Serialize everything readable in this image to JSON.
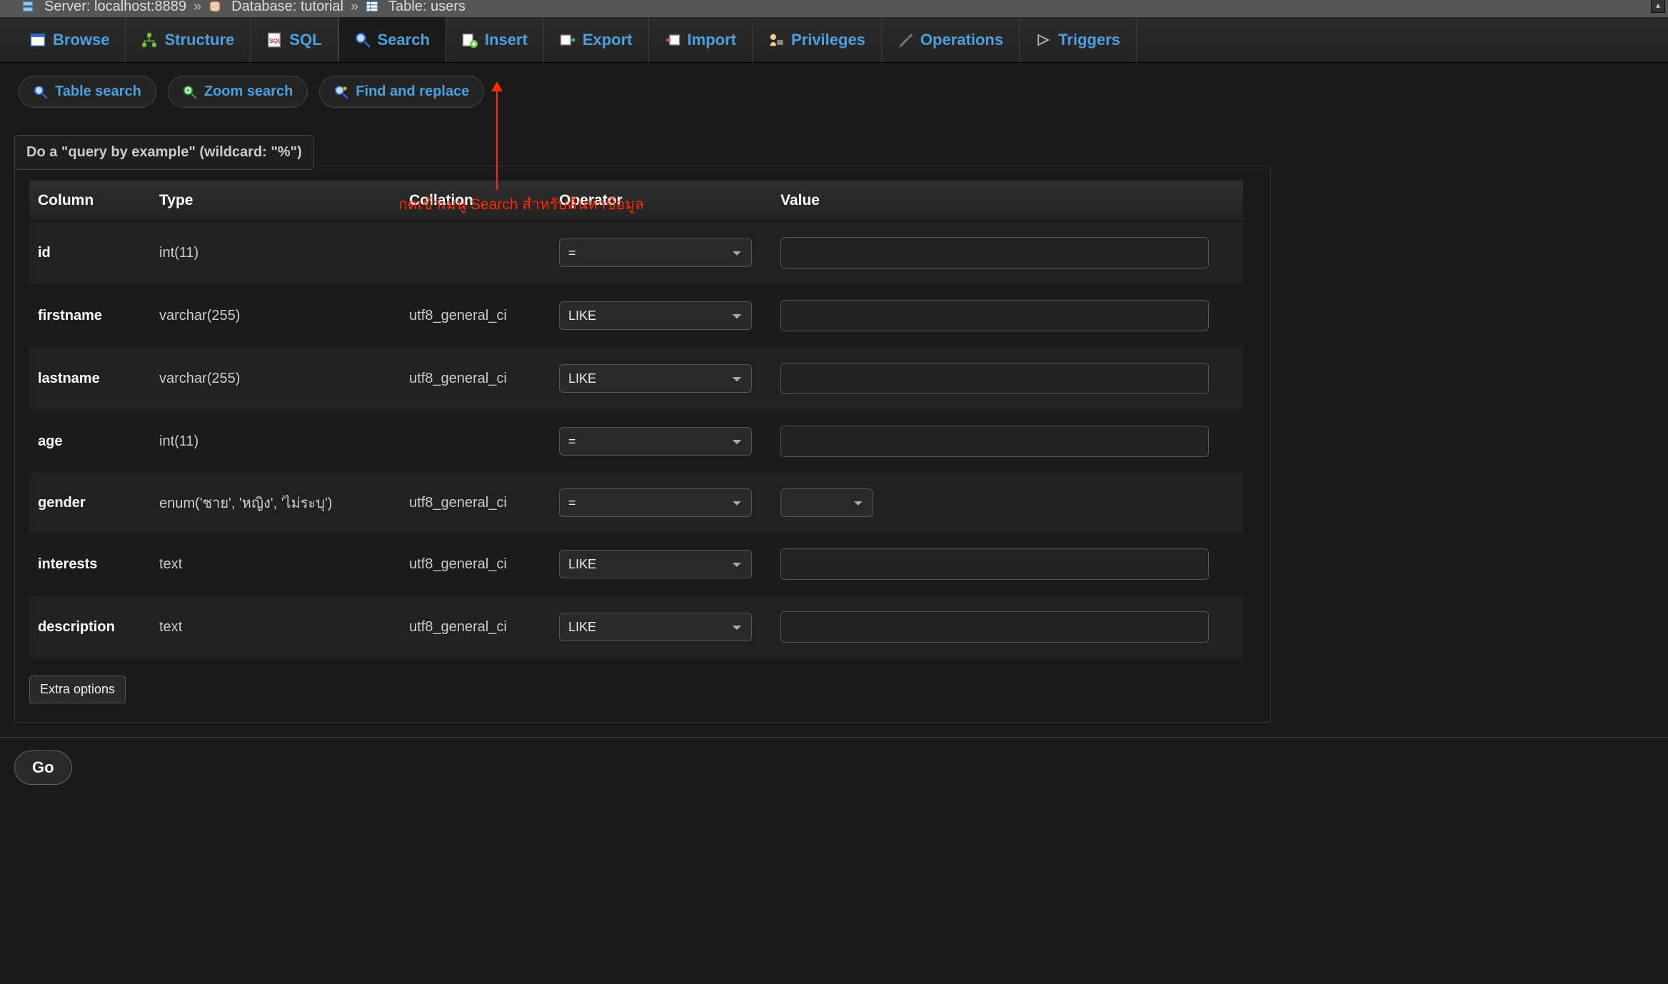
{
  "breadcrumb": {
    "server_label": "Server: localhost:8889",
    "database_label": "Database: tutorial",
    "table_label": "Table: users"
  },
  "tabs": {
    "browse": "Browse",
    "structure": "Structure",
    "sql": "SQL",
    "search": "Search",
    "insert": "Insert",
    "export": "Export",
    "import": "Import",
    "privileges": "Privileges",
    "operations": "Operations",
    "triggers": "Triggers"
  },
  "subtabs": {
    "table_search": "Table search",
    "zoom_search": "Zoom search",
    "find_replace": "Find and replace"
  },
  "annotation": "กดเข้าเมนู Search สำหรับค้นหาข้อมูล",
  "legend": "Do a \"query by example\" (wildcard: \"%\")",
  "headers": {
    "column": "Column",
    "type": "Type",
    "collation": "Collation",
    "operator": "Operator",
    "value": "Value"
  },
  "rows": [
    {
      "name": "id",
      "type": "int(11)",
      "collation": "",
      "operator": "=",
      "value_kind": "text"
    },
    {
      "name": "firstname",
      "type": "varchar(255)",
      "collation": "utf8_general_ci",
      "operator": "LIKE",
      "value_kind": "text"
    },
    {
      "name": "lastname",
      "type": "varchar(255)",
      "collation": "utf8_general_ci",
      "operator": "LIKE",
      "value_kind": "text"
    },
    {
      "name": "age",
      "type": "int(11)",
      "collation": "",
      "operator": "=",
      "value_kind": "text"
    },
    {
      "name": "gender",
      "type": "enum('ชาย', 'หญิง', 'ไม่ระบุ')",
      "collation": "utf8_general_ci",
      "operator": "=",
      "value_kind": "select"
    },
    {
      "name": "interests",
      "type": "text",
      "collation": "utf8_general_ci",
      "operator": "LIKE",
      "value_kind": "text"
    },
    {
      "name": "description",
      "type": "text",
      "collation": "utf8_general_ci",
      "operator": "LIKE",
      "value_kind": "text"
    }
  ],
  "extra_options": "Extra options",
  "go": "Go"
}
